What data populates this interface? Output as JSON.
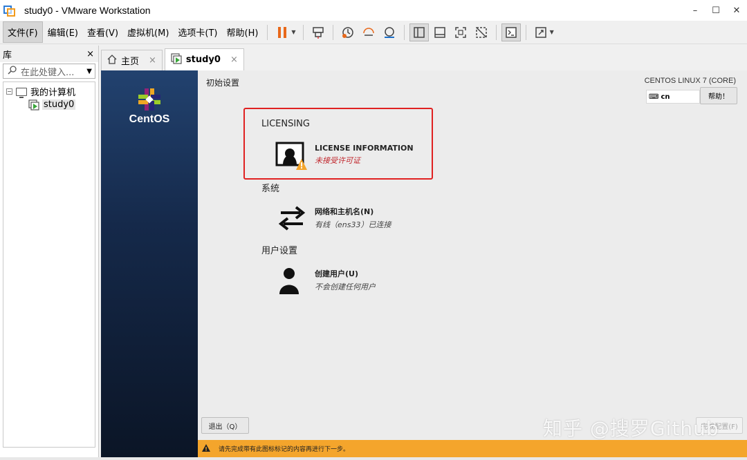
{
  "window": {
    "title": "study0 - VMware Workstation",
    "controls": [
      "–",
      "☐",
      "✕"
    ]
  },
  "menu": {
    "items": [
      "文件(F)",
      "编辑(E)",
      "查看(V)",
      "虚拟机(M)",
      "选项卡(T)",
      "帮助(H)"
    ]
  },
  "library": {
    "title": "库",
    "close": "×",
    "search_placeholder": "在此处键入...",
    "tree": {
      "root_toggle": "⊟",
      "root_label": "我的计算机",
      "vm_label": "study0"
    }
  },
  "tabs": [
    {
      "label": "主页",
      "close": "×"
    },
    {
      "label": "study0",
      "close": "×"
    }
  ],
  "installer": {
    "brand": "CentOS",
    "hub_title": "初始设置",
    "os_label": "CENTOS LINUX 7 (CORE)",
    "keyboard": "cn",
    "help_label": "帮助！",
    "categories": {
      "licensing": "LICENSING",
      "system": "系统",
      "user": "用户设置"
    },
    "spokes": {
      "license": {
        "name": "LICENSE INFORMATION",
        "status": "未接受许可证"
      },
      "network": {
        "name": "网络和主机名(N)",
        "status": "有线（ens33）已连接"
      },
      "user": {
        "name": "创建用户(U)",
        "status": "不会创建任何用户"
      }
    },
    "quit_label": "退出（Q）",
    "continue_label": "完成配置(F)",
    "warning_text": "请先完成带有此图标标记的内容再进行下一步。"
  },
  "watermark": "知乎 @搜罗Github",
  "colors": {
    "warning_bar": "#f4a52c",
    "highlight": "#e02020",
    "status_warn": "#c1272d",
    "sidebar_top": "#22426f"
  }
}
